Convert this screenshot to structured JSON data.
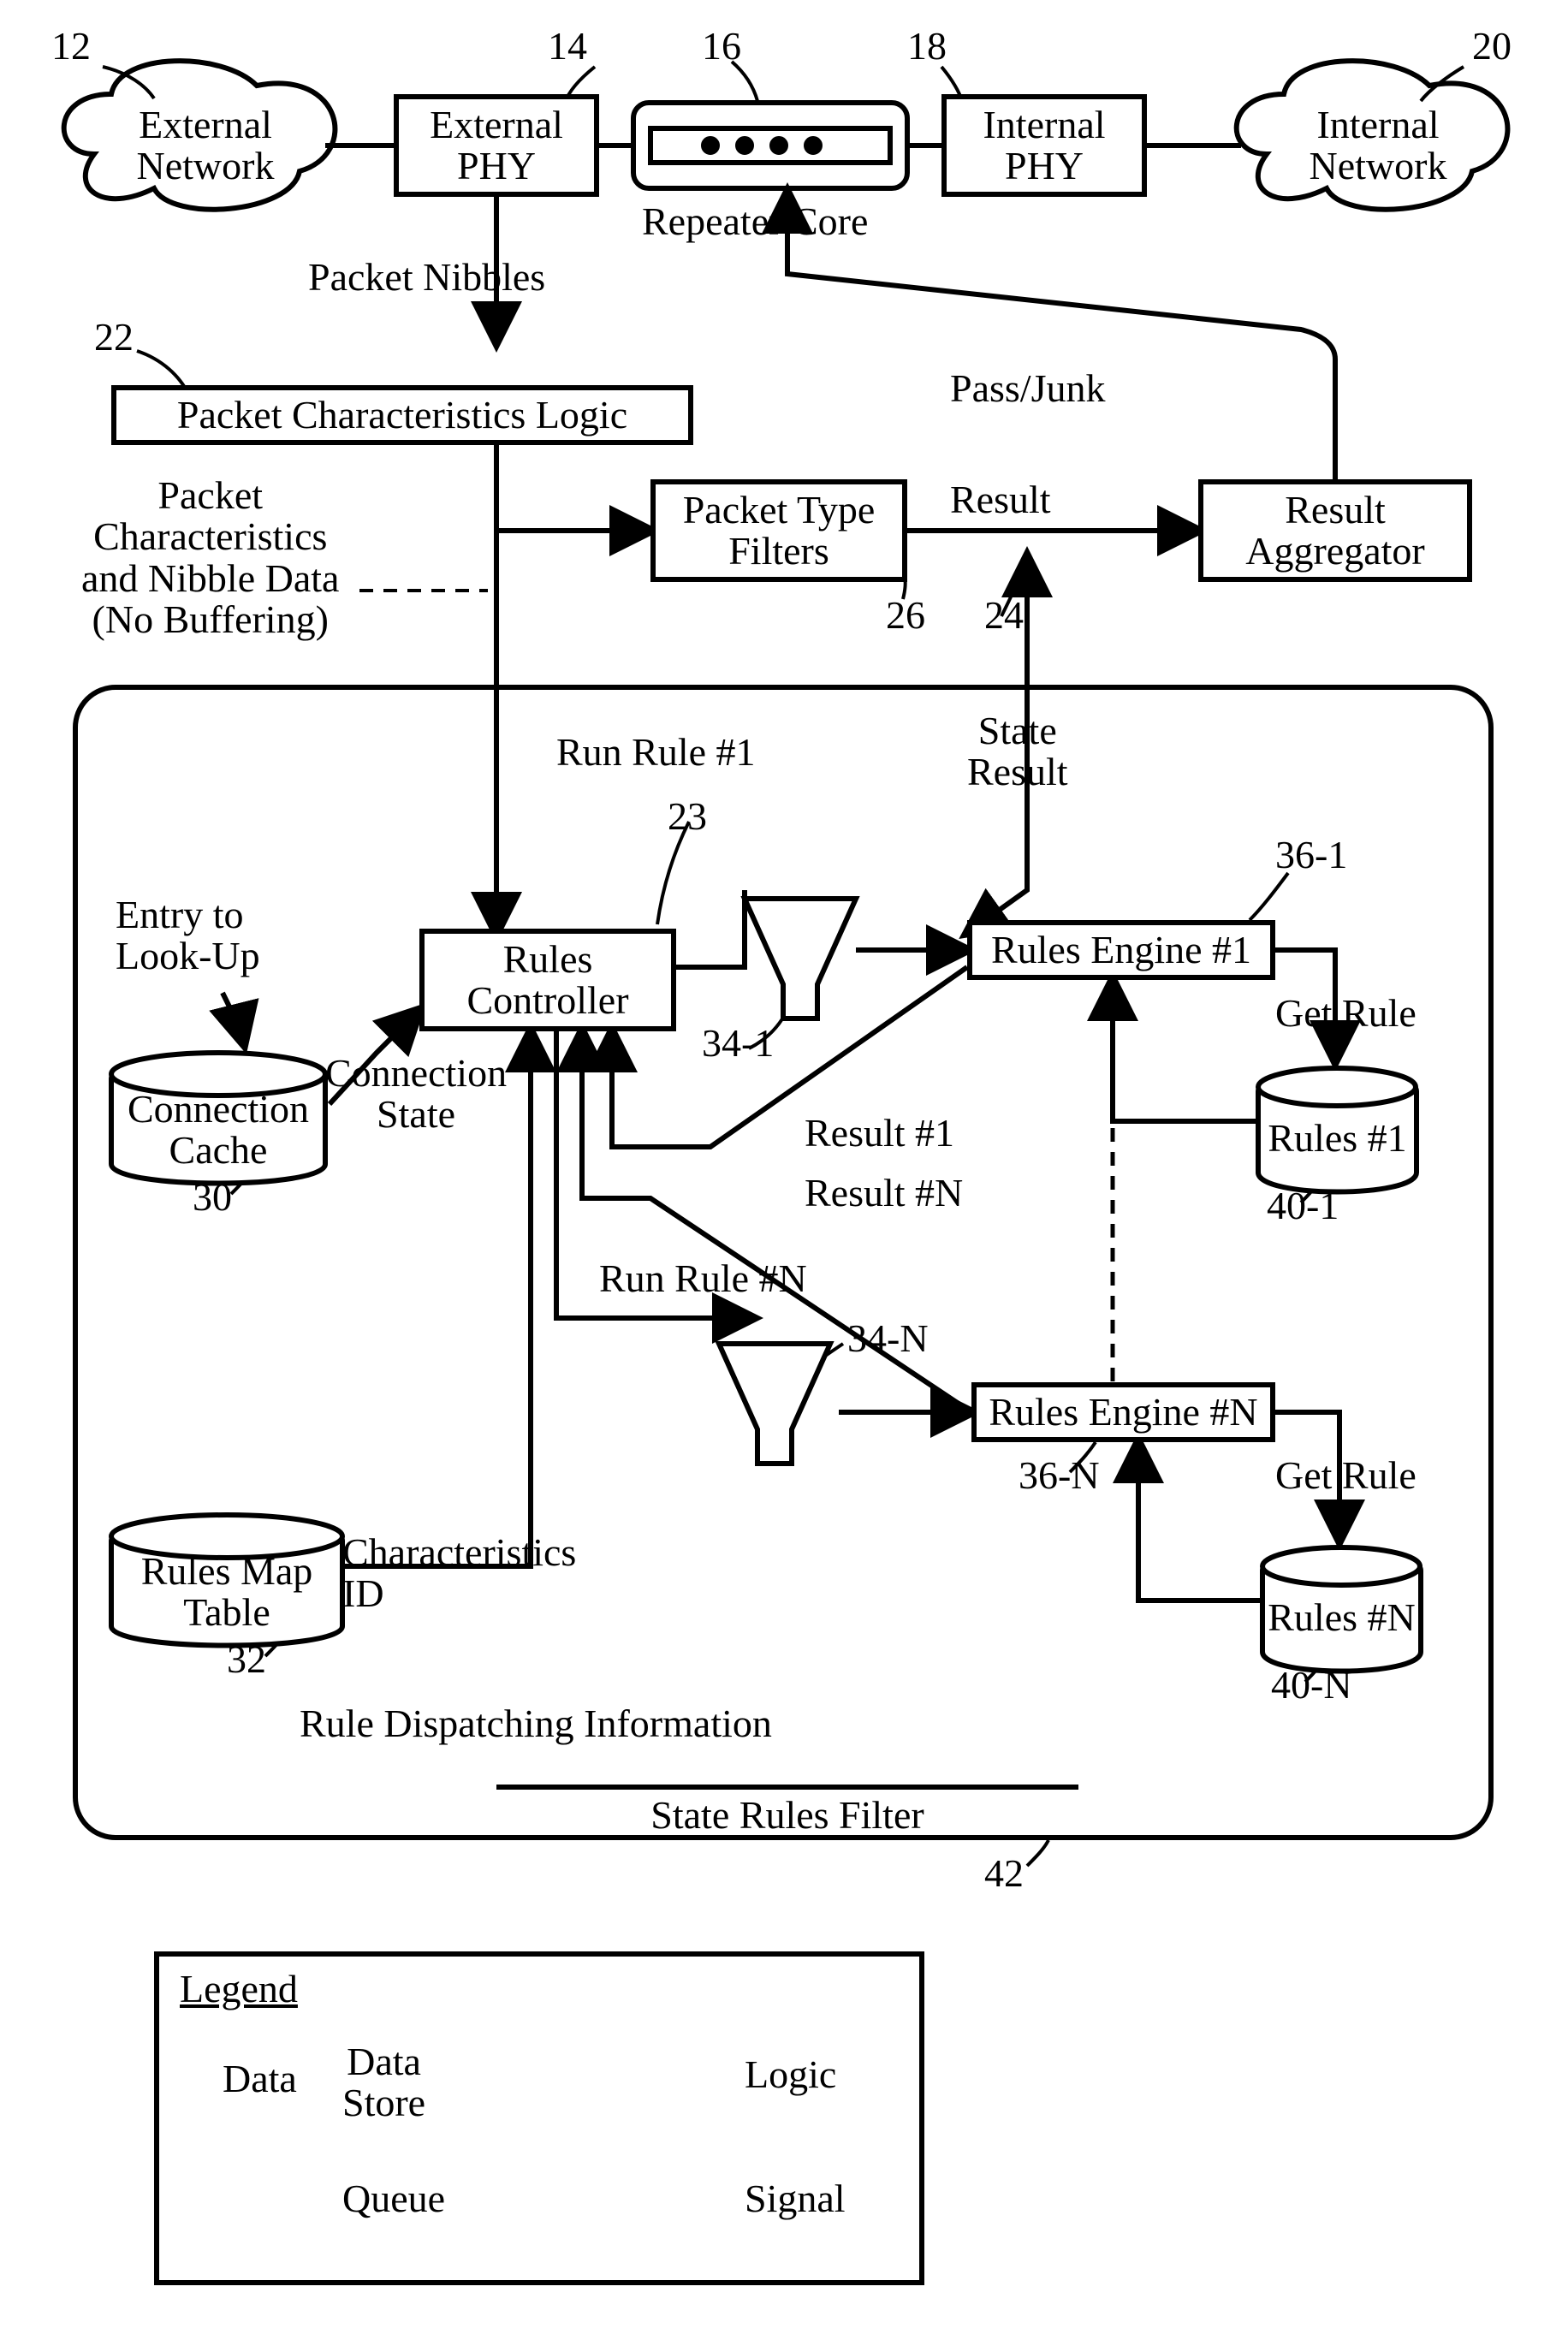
{
  "chart_data": {
    "type": "diagram",
    "top_row": {
      "n12": "12",
      "external_network": "External\nNetwork",
      "n14": "14",
      "external_phy": "External\nPHY",
      "n16": "16",
      "repeater_core": "Repeater Core",
      "n18": "18",
      "internal_phy": "Internal\nPHY",
      "n20": "20",
      "internal_network": "Internal\nNetwork"
    },
    "mid": {
      "packet_nibbles": "Packet Nibbles",
      "n22": "22",
      "pcl": "Packet Characteristics Logic",
      "pc_note": "Packet\nCharacteristics\nand Nibble Data\n(No Buffering)",
      "ptf": "Packet Type\nFilters",
      "n26": "26",
      "result": "Result",
      "n24": "24",
      "ra": "Result\nAggregator",
      "pass_junk": "Pass/Junk"
    },
    "srf": {
      "title": "State Rules Filter",
      "n42": "42",
      "run_rule_1": "Run Rule #1",
      "n23": "23",
      "state_result": "State\nResult",
      "rules_controller": "Rules\nController",
      "entry_lookup": "Entry to\nLook-Up",
      "connection_cache": "Connection\nCache",
      "n30": "30",
      "connection_state": "Connection\nState",
      "n34_1": "34-1",
      "rules_engine_1": "Rules Engine #1",
      "n36_1": "36-1",
      "get_rule_1": "Get Rule",
      "rules_1": "Rules\n#1",
      "n40_1": "40-1",
      "result_1": "Result #1",
      "result_n": "Result #N",
      "run_rule_n": "Run Rule #N",
      "n34_n": "34-N",
      "rules_engine_n": "Rules Engine #N",
      "n36_n": "36-N",
      "get_rule_n": "Get Rule",
      "rules_n": "Rules\n#N",
      "n40_n": "40-N",
      "rules_map_table": "Rules Map\nTable",
      "n32": "32",
      "char_id": "Characteristics\nID",
      "rule_dispatch": "Rule Dispatching Information"
    },
    "legend": {
      "title": "Legend",
      "data": "Data",
      "data_store": "Data\nStore",
      "logic": "Logic",
      "queue": "Queue",
      "signal": "Signal"
    }
  }
}
